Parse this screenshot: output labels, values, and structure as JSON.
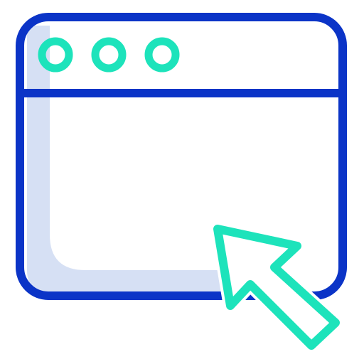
{
  "icon": {
    "name": "browser-window-cursor-icon",
    "parts": {
      "window": "browser-window-icon",
      "dots": [
        "window-dot-icon",
        "window-dot-icon",
        "window-dot-icon"
      ],
      "cursor": "cursor-arrow-icon"
    }
  },
  "colors": {
    "outline": "#0b34c7",
    "accent": "#1de3bb",
    "shadow": "#d6e0f4",
    "background": "#ffffff"
  }
}
